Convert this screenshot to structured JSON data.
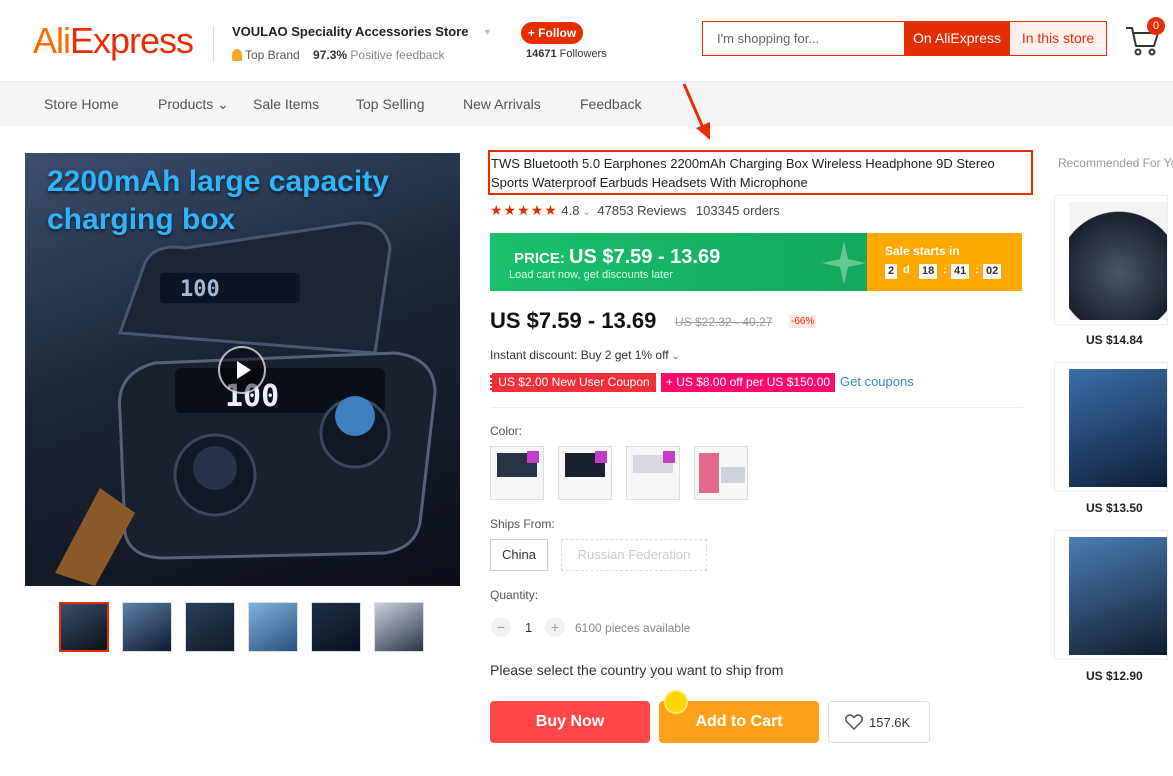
{
  "header": {
    "logo": {
      "part1": "Ali",
      "part2": "Express"
    },
    "store_name": "VOULAO Speciality Accessories Store",
    "top_brand_label": "Top Brand",
    "feedback_pct": "97.3%",
    "feedback_label": "Positive feedback",
    "follow_label": "+ Follow",
    "followers_count": "14671",
    "followers_label": "Followers",
    "search_placeholder": "I'm shopping for...",
    "search_on_ali": "On AliExpress",
    "search_in_store": "In this store",
    "cart_count": "0"
  },
  "nav": {
    "items": [
      "Store Home",
      "Products",
      "Sale Items",
      "Top Selling",
      "New Arrivals",
      "Feedback"
    ]
  },
  "gallery": {
    "main_caption_line1": "2200mAh large capacity",
    "main_caption_line2": "charging box",
    "thumbnail_count": 6
  },
  "product": {
    "title": "TWS Bluetooth 5.0 Earphones 2200mAh Charging Box Wireless Headphone 9D Stereo Sports Waterproof Earbuds Headsets With Microphone",
    "rating": "4.8",
    "reviews": "47853 Reviews",
    "orders": "103345 orders",
    "banner_price_label": "PRICE:",
    "banner_price": "US $7.59 - 13.69",
    "banner_sub": "Load cart now, get discounts later",
    "sale_starts": "Sale starts in",
    "countdown": {
      "days": "2",
      "d_label": "d",
      "hours": "18",
      "minutes": "41",
      "seconds": "02"
    },
    "price": "US $7.59 - 13.69",
    "old_price": "US $22.32 - 40.27",
    "discount": "-66%",
    "instant_discount": "Instant discount: Buy 2 get 1% off",
    "coupon1": "US $2.00 New User Coupon",
    "coupon2": "+ US $8.00 off per US $150.00",
    "get_coupons": "Get coupons",
    "color_label": "Color:",
    "ships_from_label": "Ships From:",
    "ships_from_options": [
      "China",
      "Russian Federation"
    ],
    "quantity_label": "Quantity:",
    "quantity_value": "1",
    "quantity_available": "6100 pieces available",
    "ship_note": "Please select the country you want to ship from",
    "buy_now": "Buy Now",
    "add_to_cart": "Add to Cart",
    "wishlist_count": "157.6K"
  },
  "recommended": {
    "title": "Recommended For You",
    "items": [
      {
        "price": "US $14.84"
      },
      {
        "price": "US $13.50"
      },
      {
        "price": "US $12.90"
      }
    ]
  },
  "colors": {
    "accent": "#e62e04",
    "green_banner": "#1ac06b",
    "sale_orange": "#ffa800",
    "buy_now": "#ff4747",
    "add_to_cart": "#ffa21a"
  }
}
